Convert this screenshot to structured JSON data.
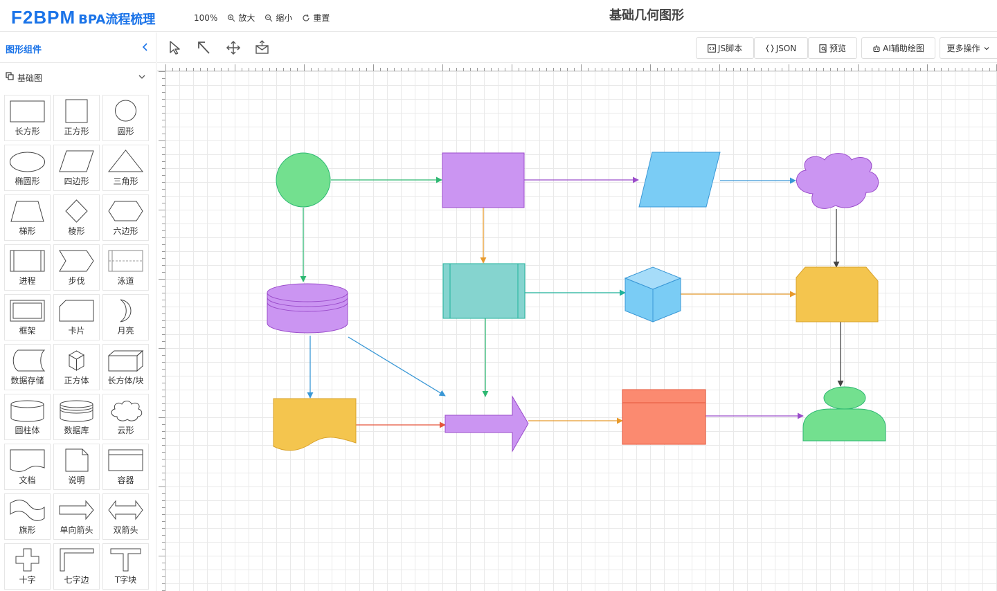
{
  "header": {
    "logo_brand": "F2BPM",
    "logo_sub": "BPA流程梳理",
    "zoom_level": "100%",
    "zoom_in_label": "放大",
    "zoom_out_label": "缩小",
    "reset_label": "重置",
    "document_title": "基础几何图形"
  },
  "sidebar": {
    "title": "图形组件",
    "group_label": "基础图",
    "shapes": [
      {
        "label": "长方形",
        "icon": "rectangle-icon"
      },
      {
        "label": "正方形",
        "icon": "square-icon"
      },
      {
        "label": "圆形",
        "icon": "circle-icon"
      },
      {
        "label": "椭圆形",
        "icon": "ellipse-icon"
      },
      {
        "label": "四边形",
        "icon": "parallelogram-icon"
      },
      {
        "label": "三角形",
        "icon": "triangle-icon"
      },
      {
        "label": "梯形",
        "icon": "trapezoid-icon"
      },
      {
        "label": "棱形",
        "icon": "diamond-icon"
      },
      {
        "label": "六边形",
        "icon": "hexagon-icon"
      },
      {
        "label": "进程",
        "icon": "process-icon"
      },
      {
        "label": "步伐",
        "icon": "step-icon"
      },
      {
        "label": "泳道",
        "icon": "swimlane-icon"
      },
      {
        "label": "框架",
        "icon": "frame-icon"
      },
      {
        "label": "卡片",
        "icon": "card-icon"
      },
      {
        "label": "月亮",
        "icon": "moon-icon"
      },
      {
        "label": "数据存储",
        "icon": "data-storage-icon"
      },
      {
        "label": "正方体",
        "icon": "cube-icon"
      },
      {
        "label": "长方体/块",
        "icon": "cuboid-icon"
      },
      {
        "label": "圆柱体",
        "icon": "cylinder-icon"
      },
      {
        "label": "数据库",
        "icon": "database-icon"
      },
      {
        "label": "云形",
        "icon": "cloud-icon"
      },
      {
        "label": "文档",
        "icon": "document-icon"
      },
      {
        "label": "说明",
        "icon": "note-icon"
      },
      {
        "label": "容器",
        "icon": "container-icon"
      },
      {
        "label": "旗形",
        "icon": "flag-icon"
      },
      {
        "label": "单向箭头",
        "icon": "single-arrow-icon"
      },
      {
        "label": "双箭头",
        "icon": "double-arrow-icon"
      },
      {
        "label": "十字",
        "icon": "cross-icon"
      },
      {
        "label": "七字边",
        "icon": "l-shape-icon"
      },
      {
        "label": "T字块",
        "icon": "t-block-icon"
      }
    ]
  },
  "toolbar": {
    "js_script_label": "JS脚本",
    "json_label": "JSON",
    "preview_label": "预览",
    "ai_label": "AI辅助绘图",
    "more_label": "更多操作"
  },
  "colors": {
    "accent": "#1a73e8",
    "green": "#73e08f",
    "purple": "#cb95f2",
    "blue": "#7accf5",
    "teal": "#85d4cf",
    "yellow": "#f4c54e",
    "salmon": "#fb8a70"
  }
}
